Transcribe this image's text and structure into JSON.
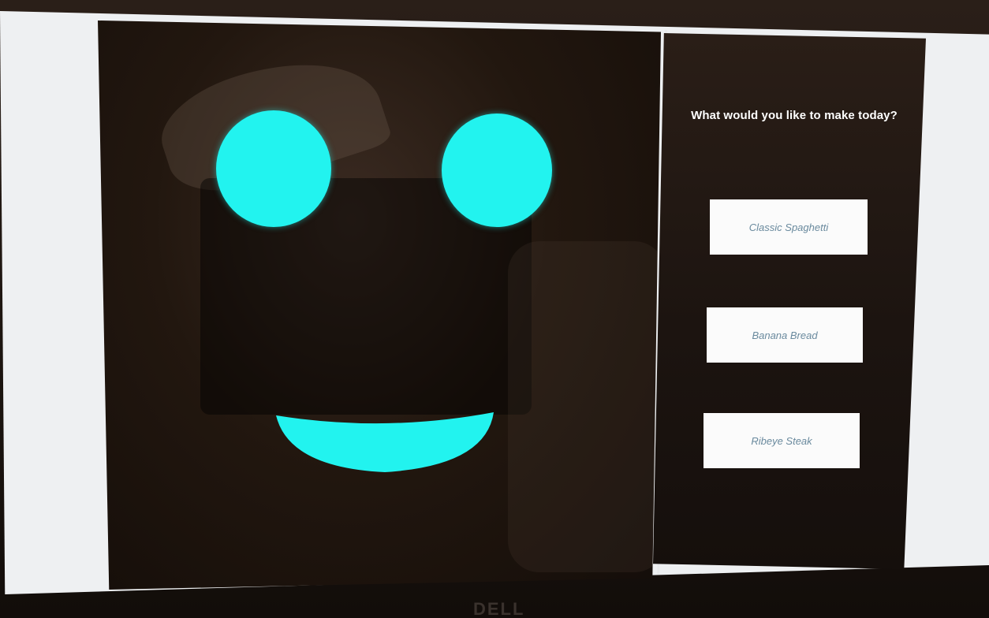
{
  "colors": {
    "face_feature": "#22f3ef",
    "button_bg": "#fbfbfb",
    "button_text": "#6a8a9e",
    "title_text": "#ffffff"
  },
  "menu": {
    "title": "What would you like to make today?",
    "options": [
      {
        "label": "Classic Spaghetti"
      },
      {
        "label": "Banana Bread"
      },
      {
        "label": "Ribeye Steak"
      }
    ]
  },
  "monitor": {
    "brand": "DELL"
  }
}
